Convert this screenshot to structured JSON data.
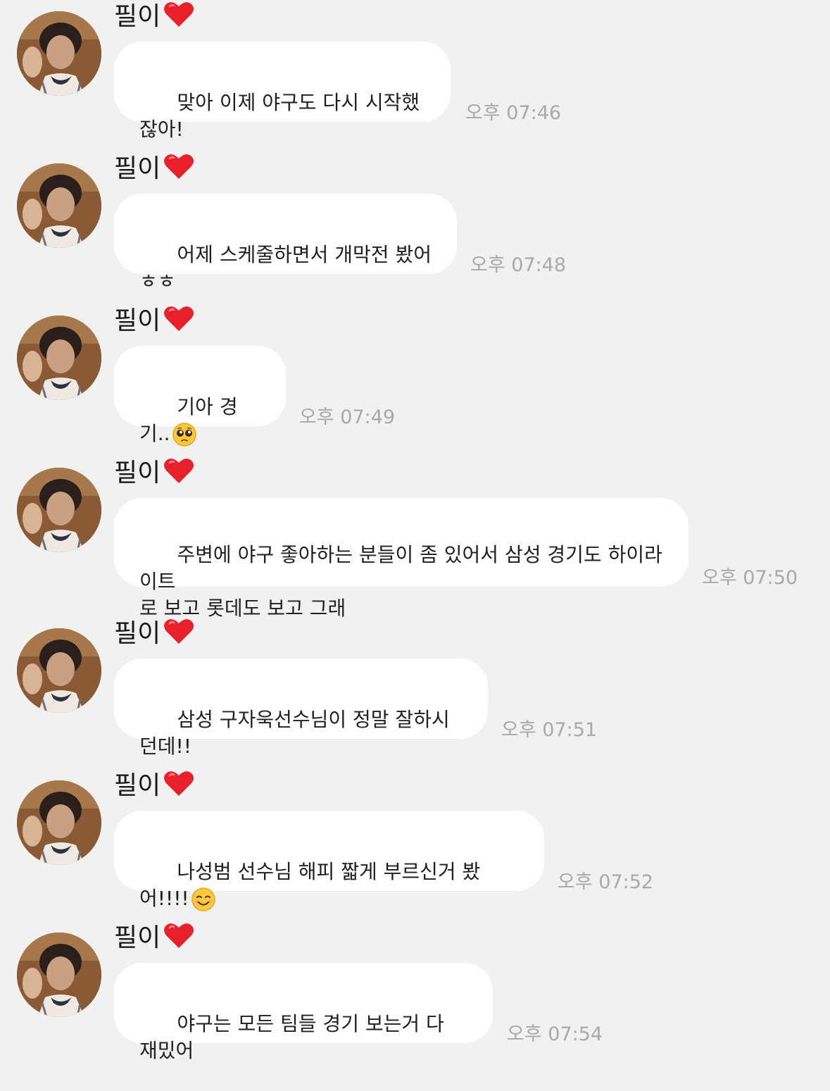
{
  "sender_name": "필이",
  "heart_icon": "red-heart-icon",
  "colors": {
    "background": "#f1f1f1",
    "bubble": "#ffffff",
    "time": "#a9a9a9",
    "heart": "#e8202b"
  },
  "messages": [
    {
      "text": "맞아 이제 야구도 다시 시작했잖아!",
      "time": "오후 07:46"
    },
    {
      "text": "어제 스케줄하면서 개막전 봤어ㅎㅎ",
      "time": "오후 07:48"
    },
    {
      "text": "기아 경기..",
      "emoji": "pleading-face-emoji",
      "time": "오후 07:49"
    },
    {
      "text": "주변에 야구 좋아하는 분들이 좀 있어서 삼성 경기도 하이라이트\n로 보고 롯데도 보고 그래",
      "time": "오후 07:50"
    },
    {
      "text": "삼성 구자욱선수님이 정말 잘하시던데!!",
      "time": "오후 07:51"
    },
    {
      "text": "나성범 선수님 해피 짧게 부르신거 봤어!!!!",
      "emoji": "smiling-face-emoji",
      "time": "오후 07:52"
    },
    {
      "text": "야구는 모든 팀들 경기 보는거 다 재밌어",
      "time": "오후 07:54"
    }
  ]
}
